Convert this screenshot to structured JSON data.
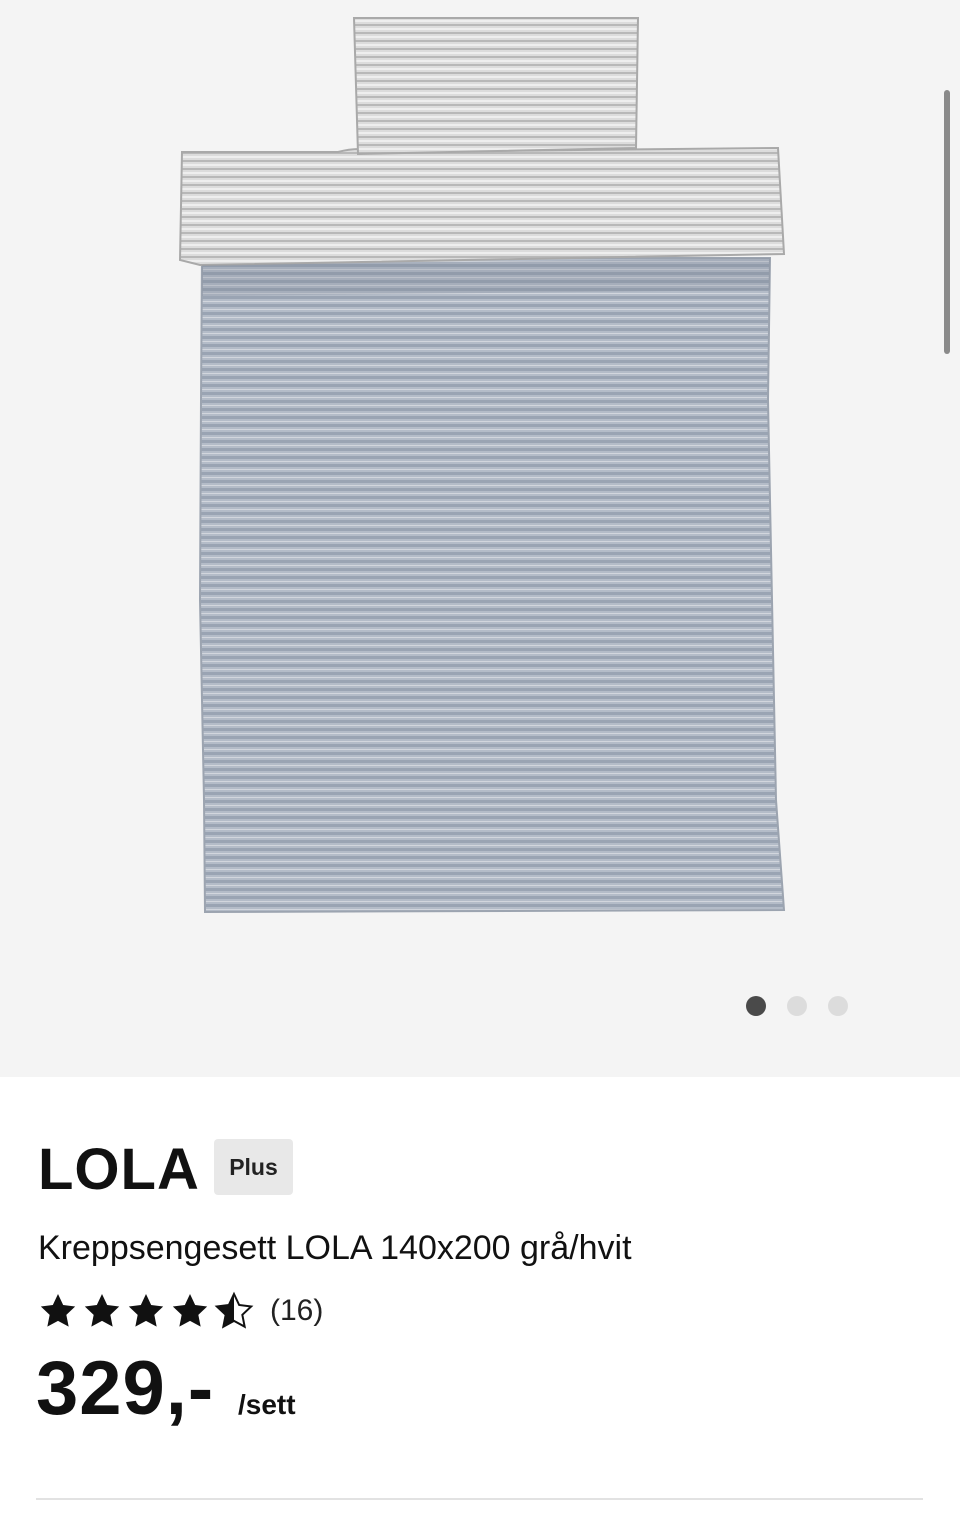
{
  "gallery": {
    "image_alt": "Kreppsengesett LOLA 140x200 grå/hvit",
    "dots_total": 3,
    "active_dot": 1
  },
  "product": {
    "brand": "LOLA",
    "badge": "Plus",
    "title": "Kreppsengesett LOLA 140x200 grå/hvit",
    "rating": 4.5,
    "rating_max": 5,
    "review_count": "(16)",
    "price": "329,-",
    "price_unit": "/sett"
  },
  "colors": {
    "gallery_bg": "#f4f4f4",
    "text": "#111111",
    "badge_bg": "#e8e8e8",
    "dot_active": "#4a4a4a",
    "dot_inactive": "#dcdcdc"
  }
}
